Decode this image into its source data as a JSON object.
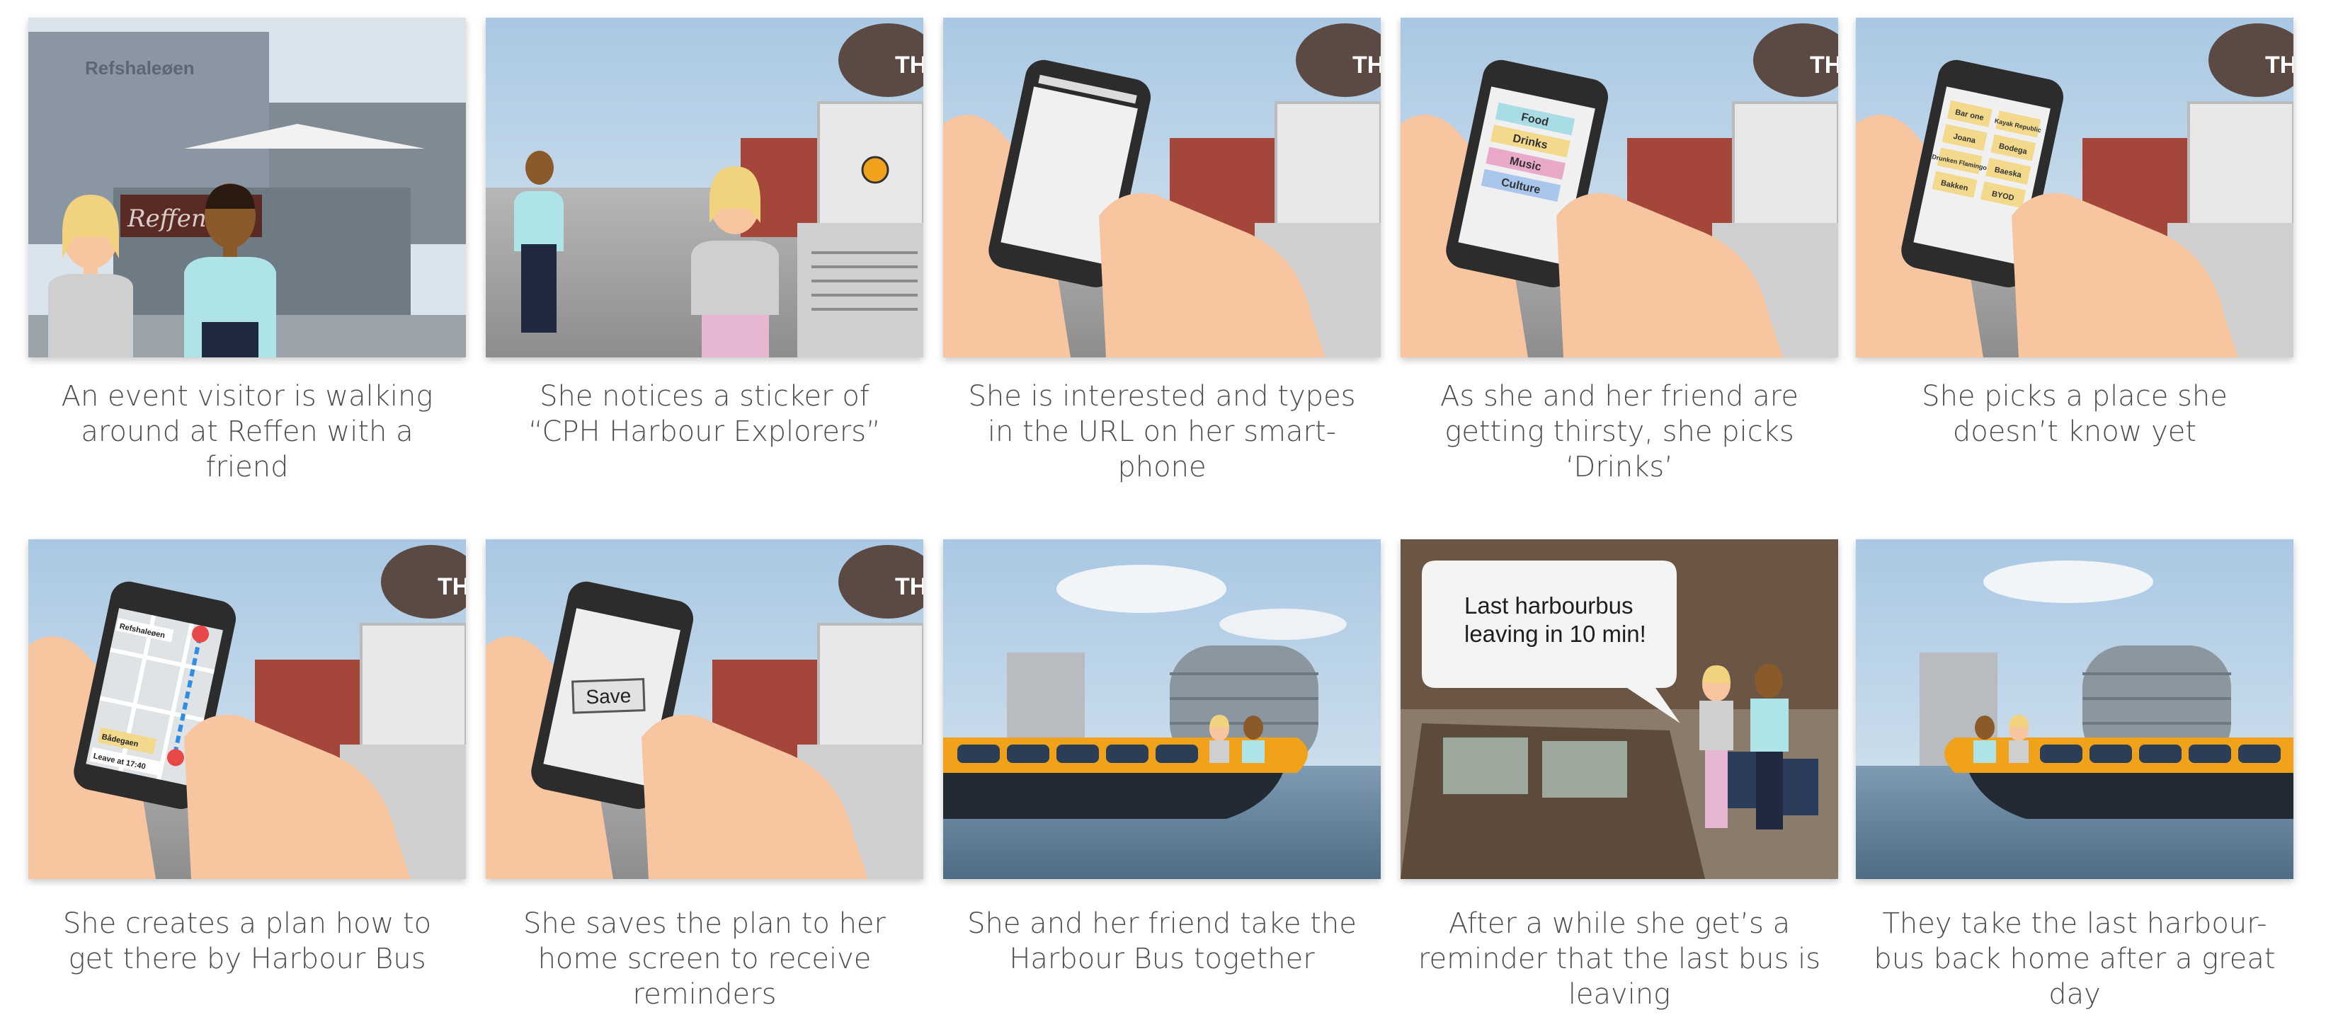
{
  "storyboard": {
    "panels": [
      {
        "id": 1,
        "caption": "An event visitor is walking\naround at Reffen with a\nfriend",
        "sign_text": "Refshaleøen",
        "banner_text": "Reffen"
      },
      {
        "id": 2,
        "caption": "She notices a sticker of\n“CPH Harbour Explorers”",
        "logo_text": "TH"
      },
      {
        "id": 3,
        "caption": "She is interested and types\nin the URL on her smart-\nphone",
        "logo_text": "TH"
      },
      {
        "id": 4,
        "caption": "As she and her friend are\ngetting thirsty, she picks\n‘Drinks’",
        "logo_text": "TH",
        "menu": [
          "Food",
          "Drinks",
          "Music",
          "Culture"
        ]
      },
      {
        "id": 5,
        "caption": "She picks a place she\ndoesn’t know yet",
        "logo_text": "TH",
        "places": [
          "Bar one",
          "Kayak\nRepublic",
          "Joana",
          "Bodega",
          "Drunken\nFlamingo",
          "Baeska",
          "Bakken",
          "BYOD"
        ]
      },
      {
        "id": 6,
        "caption": "She creates a plan how to\nget there by Harbour Bus",
        "logo_text": "TH",
        "map_labels": [
          "Refshaleøen",
          "Bådegaen",
          "Leave at 17:40"
        ]
      },
      {
        "id": 7,
        "caption": "She saves the plan to her\nhome screen to receive\nreminders",
        "logo_text": "TH",
        "button_label": "Save"
      },
      {
        "id": 8,
        "caption": "She and her friend take the\nHarbour Bus together"
      },
      {
        "id": 9,
        "caption": "After a while she get’s a\nreminder that the last bus is\nleaving",
        "bubble_line1": "Last harbourbus",
        "bubble_line2": "leaving in 10 min!"
      },
      {
        "id": 10,
        "caption": "They take the last harbour-\nbus back home after a great\nday"
      }
    ]
  },
  "colors": {
    "sky": "#c9dcea",
    "skin_hand": "#f7c59f",
    "phone_body": "#2c2c2c",
    "boat_hull": "#f0a31a",
    "water": "#6f8fa8",
    "menu_food": "#a9dde6",
    "menu_drinks": "#f3d98c",
    "menu_music": "#e9a9c9",
    "menu_culture": "#a9c6ec"
  }
}
